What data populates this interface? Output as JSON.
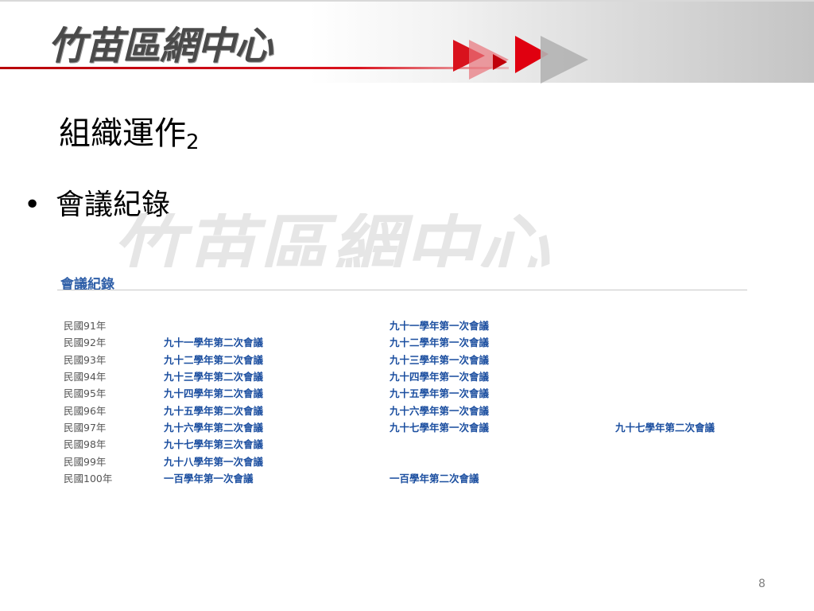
{
  "header": {
    "logo_text": "竹苗區網中心"
  },
  "slide": {
    "title": "組織運作",
    "title_sub": "2",
    "bullet_marker": "•",
    "bullet_text": "會議紀錄"
  },
  "watermark": "竹苗區網中心",
  "web": {
    "heading": "會議紀錄",
    "rows": [
      {
        "year": "民國91年",
        "c1": "",
        "c2": "九十一學年第一次會議",
        "c3": ""
      },
      {
        "year": "民國92年",
        "c1": "九十一學年第二次會議",
        "c2": "九十二學年第一次會議",
        "c3": ""
      },
      {
        "year": "民國93年",
        "c1": "九十二學年第二次會議",
        "c2": "九十三學年第一次會議",
        "c3": ""
      },
      {
        "year": "民國94年",
        "c1": "九十三學年第二次會議",
        "c2": "九十四學年第一次會議",
        "c3": ""
      },
      {
        "year": "民國95年",
        "c1": "九十四學年第二次會議",
        "c2": "九十五學年第一次會議",
        "c3": ""
      },
      {
        "year": "民國96年",
        "c1": "九十五學年第二次會議",
        "c2": "九十六學年第一次會議",
        "c3": ""
      },
      {
        "year": "民國97年",
        "c1": "九十六學年第二次會議",
        "c2": "九十七學年第一次會議",
        "c3": "九十七學年第二次會議"
      },
      {
        "year": "民國98年",
        "c1": "九十七學年第三次會議",
        "c2": "",
        "c3": ""
      },
      {
        "year": "民國99年",
        "c1": "九十八學年第一次會議",
        "c2": "",
        "c3": ""
      },
      {
        "year": "民國100年",
        "c1": "一百學年第一次會議",
        "c2": "一百學年第二次會議",
        "c3": ""
      }
    ]
  },
  "page_number": "8",
  "colors": {
    "accent_red": "#d9121d",
    "link_blue": "#1c4fa0",
    "heading_blue": "#2f5fa8"
  }
}
